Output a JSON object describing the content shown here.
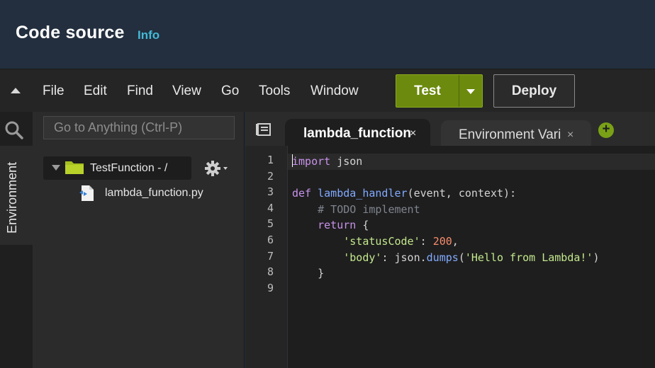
{
  "header": {
    "title": "Code source",
    "info_label": "Info"
  },
  "menubar": {
    "collapse_icon": "caret-up-icon",
    "items": [
      "File",
      "Edit",
      "Find",
      "View",
      "Go",
      "Tools",
      "Window"
    ],
    "test_label": "Test",
    "deploy_label": "Deploy"
  },
  "rail": {
    "search_icon": "search-icon",
    "environment_tab": "Environment"
  },
  "filetree": {
    "goto_placeholder": "Go to Anything (Ctrl-P)",
    "folder_label": "TestFunction - /",
    "file_label": "lambda_function.py"
  },
  "editor": {
    "tabs": [
      {
        "label": "lambda_function",
        "active": true
      },
      {
        "label": "Environment Vari",
        "active": false
      }
    ],
    "add_tab_label": "+",
    "close_glyph": "×",
    "line_numbers": [
      "1",
      "2",
      "3",
      "4",
      "5",
      "6",
      "7",
      "8",
      "9"
    ],
    "code_lines": [
      "import json",
      "",
      "def lambda_handler(event, context):",
      "    # TODO implement",
      "    return {",
      "        'statusCode': 200,",
      "        'body': json.dumps('Hello from Lambda!')",
      "    }",
      ""
    ]
  },
  "colors": {
    "header_bg": "#232f3e",
    "info_link": "#44b9d6",
    "test_button": "#6c8a0d",
    "add_tab": "#7aa116",
    "editor_bg": "#1e1e1e"
  }
}
